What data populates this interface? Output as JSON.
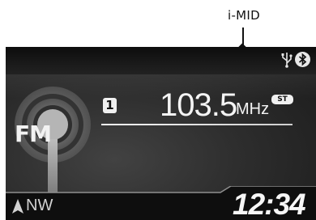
{
  "callout": {
    "label": "i-MID"
  },
  "status": {
    "usb_icon": "usb-icon",
    "bluetooth_icon": "bluetooth-icon"
  },
  "radio": {
    "band": "FM",
    "preset": "1",
    "frequency": "103.5",
    "unit": "MHz",
    "stereo": "ST"
  },
  "footer": {
    "compass": "NW",
    "clock": "12:34"
  },
  "colors": {
    "screen_bg": "#2d2d2d",
    "text": "#f4f4f4",
    "badge": "#f0f0f0"
  }
}
